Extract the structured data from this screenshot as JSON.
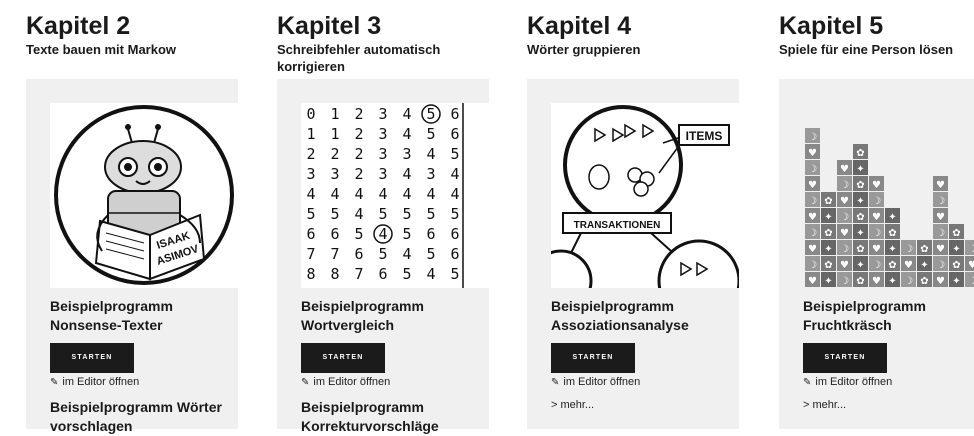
{
  "columns": [
    {
      "kapitel": "Kapitel 2",
      "subtitle": "Texte bauen mit Markow",
      "program_title": "Beispielprogramm Nonsense-Texter",
      "start_label": "STARTEN",
      "editor_label": "im Editor öffnen",
      "next_program_title": "Beispielprogramm Wörter vorschlagen",
      "image_text": [
        "ISAAK",
        "ASIMOV"
      ]
    },
    {
      "kapitel": "Kapitel 3",
      "subtitle": "Schreibfehler automatisch korrigieren",
      "program_title": "Beispielprogramm Wortvergleich",
      "start_label": "STARTEN",
      "editor_label": "im Editor öffnen",
      "next_program_title": "Beispielprogramm Korrekturvorschläge",
      "image_rows": [
        [
          "0",
          "1",
          "2",
          "3",
          "4",
          "5",
          "6"
        ],
        [
          "1",
          "1",
          "2",
          "3",
          "4",
          "5",
          "6"
        ],
        [
          "2",
          "2",
          "2",
          "3",
          "3",
          "4",
          "5"
        ],
        [
          "3",
          "3",
          "2",
          "3",
          "4",
          "3",
          "4"
        ],
        [
          "4",
          "4",
          "4",
          "4",
          "4",
          "4",
          "4"
        ],
        [
          "5",
          "5",
          "4",
          "5",
          "5",
          "5",
          "5"
        ],
        [
          "6",
          "6",
          "5",
          "4",
          "5",
          "6",
          "6"
        ],
        [
          "7",
          "7",
          "6",
          "5",
          "4",
          "5",
          "6"
        ],
        [
          "8",
          "8",
          "7",
          "6",
          "5",
          "4",
          "5"
        ]
      ]
    },
    {
      "kapitel": "Kapitel 4",
      "subtitle": "Wörter gruppieren",
      "program_title": "Beispielprogramm Assoziationsanalyse",
      "start_label": "STARTEN",
      "editor_label": "im Editor öffnen",
      "more_label": "> mehr...",
      "image_text": [
        "ITEMS",
        "TRANSAKTIONEN"
      ]
    },
    {
      "kapitel": "Kapitel 5",
      "subtitle": "Spiele für eine Person lösen",
      "program_title": "Beispielprogramm Fruchtkräsch",
      "start_label": "STARTEN",
      "editor_label": "im Editor öffnen",
      "more_label": "> mehr..."
    }
  ],
  "icons": {
    "editor": "edit-icon"
  }
}
